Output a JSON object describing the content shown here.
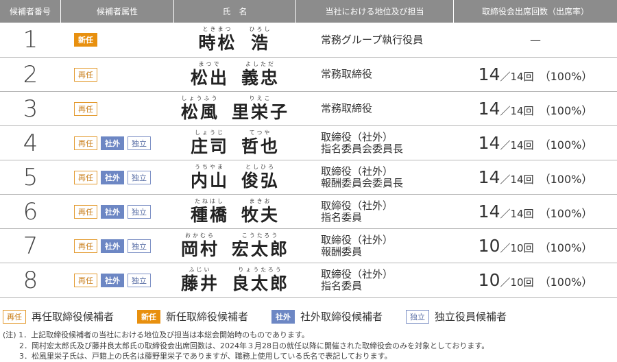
{
  "header": {
    "no": "候補者番号",
    "attr": "候補者属性",
    "name": "氏　名",
    "position": "当社における地位及び担当",
    "attendance": "取締役会出席回数（出席率）"
  },
  "candidates": [
    {
      "no": "1",
      "badges": [
        {
          "key": "new",
          "label": "新任"
        }
      ],
      "surname": "時松",
      "surname_kana": "ときまつ",
      "given": "浩",
      "given_kana": "ひろし",
      "position": [
        "常務グループ執行役員"
      ],
      "attendance": {
        "text": "—"
      }
    },
    {
      "no": "2",
      "badges": [
        {
          "key": "rein",
          "label": "再任"
        }
      ],
      "surname": "松出",
      "surname_kana": "まつで",
      "given": "義忠",
      "given_kana": "よしただ",
      "position": [
        "常務取締役"
      ],
      "attendance": {
        "attended": "14",
        "held": "／14回",
        "rate": "（100%）"
      }
    },
    {
      "no": "3",
      "badges": [
        {
          "key": "rein",
          "label": "再任"
        }
      ],
      "surname": "松風",
      "surname_kana": "しょうふう",
      "given": "里栄子",
      "given_kana": "りえこ",
      "position": [
        "常務取締役"
      ],
      "attendance": {
        "attended": "14",
        "held": "／14回",
        "rate": "（100%）"
      }
    },
    {
      "no": "4",
      "badges": [
        {
          "key": "rein",
          "label": "再任"
        },
        {
          "key": "ext",
          "label": "社外"
        },
        {
          "key": "ind",
          "label": "独立"
        }
      ],
      "surname": "庄司",
      "surname_kana": "しょうじ",
      "given": "哲也",
      "given_kana": "てつや",
      "position": [
        "取締役（社外）",
        "指名委員会委員長"
      ],
      "attendance": {
        "attended": "14",
        "held": "／14回",
        "rate": "（100%）"
      }
    },
    {
      "no": "5",
      "badges": [
        {
          "key": "rein",
          "label": "再任"
        },
        {
          "key": "ext",
          "label": "社外"
        },
        {
          "key": "ind",
          "label": "独立"
        }
      ],
      "surname": "内山",
      "surname_kana": "うちやま",
      "given": "俊弘",
      "given_kana": "としひろ",
      "position": [
        "取締役（社外）",
        "報酬委員会委員長"
      ],
      "attendance": {
        "attended": "14",
        "held": "／14回",
        "rate": "（100%）"
      }
    },
    {
      "no": "6",
      "badges": [
        {
          "key": "rein",
          "label": "再任"
        },
        {
          "key": "ext",
          "label": "社外"
        },
        {
          "key": "ind",
          "label": "独立"
        }
      ],
      "surname": "種橋",
      "surname_kana": "たねはし",
      "given": "牧夫",
      "given_kana": "まきお",
      "position": [
        "取締役（社外）",
        "指名委員"
      ],
      "attendance": {
        "attended": "14",
        "held": "／14回",
        "rate": "（100%）"
      }
    },
    {
      "no": "7",
      "badges": [
        {
          "key": "rein",
          "label": "再任"
        },
        {
          "key": "ext",
          "label": "社外"
        },
        {
          "key": "ind",
          "label": "独立"
        }
      ],
      "surname": "岡村",
      "surname_kana": "おかむら",
      "given": "宏太郎",
      "given_kana": "こうたろう",
      "position": [
        "取締役（社外）",
        "報酬委員"
      ],
      "attendance": {
        "attended": "10",
        "held": "／10回",
        "rate": "（100%）"
      }
    },
    {
      "no": "8",
      "badges": [
        {
          "key": "rein",
          "label": "再任"
        },
        {
          "key": "ext",
          "label": "社外"
        },
        {
          "key": "ind",
          "label": "独立"
        }
      ],
      "surname": "藤井",
      "surname_kana": "ふじい",
      "given": "良太郎",
      "given_kana": "りょうたろう",
      "position": [
        "取締役（社外）",
        "指名委員"
      ],
      "attendance": {
        "attended": "10",
        "held": "／10回",
        "rate": "（100%）"
      }
    }
  ],
  "legend": [
    {
      "key": "rein",
      "label": "再任",
      "text": "再任取締役候補者"
    },
    {
      "key": "new",
      "label": "新任",
      "text": "新任取締役候補者"
    },
    {
      "key": "ext",
      "label": "社外",
      "text": "社外取締役候補者"
    },
    {
      "key": "ind",
      "label": "独立",
      "text": "独立役員候補者"
    }
  ],
  "notes": [
    "(注) 1．上記取締役候補者の当社における地位及び担当は本総会開始時のものであります。",
    "2．岡村宏太郎氏及び藤井良太郎氏の取締役会出席回数は、2024年３月28日の就任以降に開催された取締役会のみを対象としております。",
    "3．松風里栄子氏は、戸籍上の氏名は藤野里栄子でありますが、職務上使用している氏名で表記しております。"
  ],
  "colors": {
    "header_bg": "#8c8c8c",
    "new": "#e8900f",
    "rein": "#e39a2e",
    "ext": "#6d87c4",
    "ind": "#7b8fc4"
  }
}
